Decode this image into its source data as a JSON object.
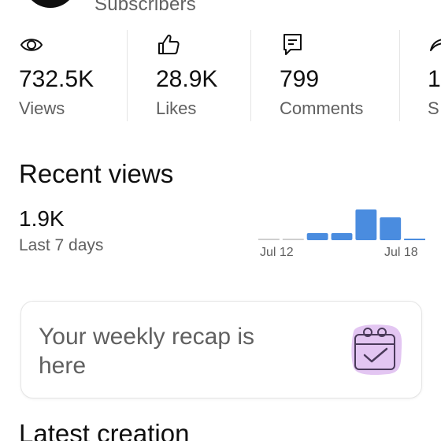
{
  "header": {
    "subscribers_label": "Subscribers"
  },
  "stats": [
    {
      "icon": "eye-icon",
      "value": "732.5K",
      "label": "Views"
    },
    {
      "icon": "thumbs-up-icon",
      "value": "28.9K",
      "label": "Likes"
    },
    {
      "icon": "comment-icon",
      "value": "799",
      "label": "Comments"
    },
    {
      "icon": "share-icon",
      "value": "1",
      "label": "S"
    }
  ],
  "recent_views": {
    "title": "Recent views",
    "value": "1.9K",
    "period": "Last 7 days",
    "start_label": "Jul 12",
    "end_label": "Jul 18",
    "bar_color": "#4a8cdf",
    "empty_color": "#cfcfcf",
    "daily_levels": [
      0,
      0,
      0.18,
      0.18,
      0.78,
      0.58,
      0.02
    ]
  },
  "recap_card": {
    "text": "Your weekly recap is here",
    "icon": "calendar-check-icon",
    "icon_bg_color": "#e3c6f2"
  },
  "latest": {
    "title": "Latest creation"
  }
}
